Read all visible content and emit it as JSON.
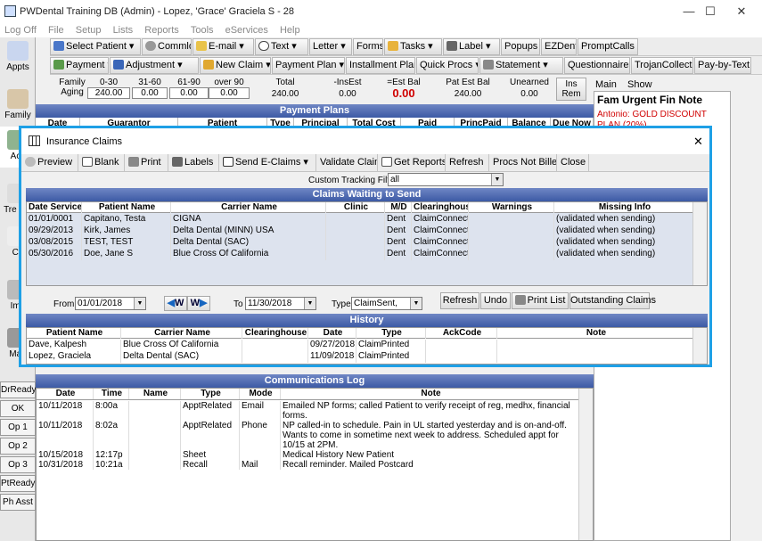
{
  "title": "PWDental Training DB (Admin) - Lopez, 'Grace' Graciela S - 28",
  "window_controls": {
    "minimize": "—",
    "maximize": "☐",
    "close": "✕"
  },
  "menu": [
    "Log Off",
    "File",
    "Setup",
    "Lists",
    "Reports",
    "Tools",
    "eServices",
    "Help"
  ],
  "toolbar1": [
    "Select Patient",
    "Commlog",
    "E-mail",
    "Text",
    "Letter",
    "Forms",
    "Tasks",
    "Label",
    "Popups",
    "EZDent",
    "PromptCalls"
  ],
  "toolbar2": [
    "Payment",
    "Adjustment",
    "New Claim",
    "Payment Plan",
    "Installment Plan",
    "Quick Procs",
    "Statement",
    "Questionnaire",
    "TrojanCollect",
    "Pay-by-Text"
  ],
  "modules": [
    "Appts",
    "Family",
    "Acc",
    "Tre Pla",
    "Ch",
    "Ima",
    "Man"
  ],
  "status_buttons": [
    "DrReady",
    "OK",
    "Op 1",
    "Op 2",
    "Op 3",
    "PtReady",
    "Ph Asst"
  ],
  "aging": {
    "family_label": "Family",
    "aging_label": "Aging",
    "cols": [
      "0-30",
      "31-60",
      "61-90",
      "over 90"
    ],
    "values": [
      "240.00",
      "0.00",
      "0.00",
      "0.00"
    ],
    "total_label": "Total",
    "total": "240.00",
    "ins_est_label": "-InsEst",
    "ins_est": "0.00",
    "est_bal_label": "=Est Bal",
    "est_bal": "0.00",
    "pat_est_label": "Pat Est Bal",
    "pat_est": "240.00",
    "unearned_label": "Unearned",
    "unearned": "0.00",
    "ins_rem": "Ins Rem"
  },
  "right_panel": {
    "tab_main": "Main",
    "tab_show": "Show",
    "urgent_title": "Fam Urgent Fin Note",
    "urgent_text": "Antonio: GOLD DISCOUNT PLAN (20%)"
  },
  "payment_plans": {
    "title": "Payment Plans",
    "cols": [
      "Date",
      "Guarantor",
      "Patient",
      "Type",
      "Principal",
      "Total Cost",
      "Paid",
      "PrincPaid",
      "Balance",
      "Due Now"
    ]
  },
  "dialog": {
    "title": "Insurance Claims",
    "close": "✕",
    "toolbar": [
      "Preview",
      "Blank",
      "Print",
      "Labels",
      "Send E-Claims",
      "Validate Claims",
      "Get Reports",
      "Refresh",
      "Procs Not Billed",
      "Close"
    ],
    "filter_label": "Custom Tracking Filter",
    "filter_value": "all",
    "waiting": {
      "title": "Claims Waiting to Send",
      "cols": [
        "Date Service",
        "Patient Name",
        "Carrier Name",
        "Clinic",
        "M/D",
        "Clearinghouse",
        "Warnings",
        "Missing Info"
      ],
      "rows": [
        [
          "01/01/0001",
          "Capitano, Testa",
          "CIGNA",
          "",
          "Dent",
          "ClaimConnect",
          "",
          "(validated when sending)"
        ],
        [
          "09/29/2013",
          "Kirk, James",
          "Delta Dental (MINN) USA",
          "",
          "Dent",
          "ClaimConnect",
          "",
          "(validated when sending)"
        ],
        [
          "03/08/2015",
          "TEST, TEST",
          "Delta Dental (SAC)",
          "",
          "Dent",
          "ClaimConnect",
          "",
          "(validated when sending)"
        ],
        [
          "05/30/2016",
          "Doe, Jane S",
          "Blue Cross Of California",
          "",
          "Dent",
          "ClaimConnect",
          "",
          "(validated when sending)"
        ]
      ]
    },
    "from_label": "From",
    "from_value": "01/01/2018",
    "to_label": "To",
    "to_value": "11/30/2018",
    "type_label": "Type",
    "type_value": "ClaimSent, Claim",
    "w_left": "W",
    "w_right": "W",
    "hist_buttons": [
      "Refresh",
      "Undo",
      "Print List",
      "Outstanding Claims"
    ],
    "history": {
      "title": "History",
      "cols": [
        "Patient Name",
        "Carrier Name",
        "Clearinghouse",
        "Date",
        "Type",
        "AckCode",
        "Note"
      ],
      "rows": [
        [
          "Dave, Kalpesh",
          "Blue Cross Of California",
          "",
          "09/27/2018",
          "ClaimPrinted",
          "",
          ""
        ],
        [
          "Lopez, Graciela",
          "Delta Dental (SAC)",
          "",
          "11/09/2018",
          "ClaimPrinted",
          "",
          ""
        ]
      ]
    }
  },
  "commlog": {
    "title": "Communications Log",
    "cols": [
      "Date",
      "Time",
      "Name",
      "Type",
      "Mode",
      "Note"
    ],
    "rows": [
      [
        "10/11/2018",
        "8:00a",
        "",
        "ApptRelated",
        "Email",
        "Emailed NP forms; called Patient to verify receipt of reg, medhx, financial forms."
      ],
      [
        "10/11/2018",
        "8:02a",
        "",
        "ApptRelated",
        "Phone",
        "NP called-in to schedule. Pain in UL started yesterday and is on-and-off. Wants to come in sometime next week to address.  Scheduled appt for 10/15 at 2PM."
      ],
      [
        "10/15/2018",
        "12:17p",
        "",
        "Sheet",
        "",
        "Medical History New Patient"
      ],
      [
        "10/31/2018",
        "10:21a",
        "",
        "Recall",
        "Mail",
        "Recall reminder.  Mailed Postcard"
      ]
    ]
  },
  "colors": {
    "accent": "#1ea0e6",
    "header_blue": "#3c5aa5",
    "red": "#d00000"
  }
}
